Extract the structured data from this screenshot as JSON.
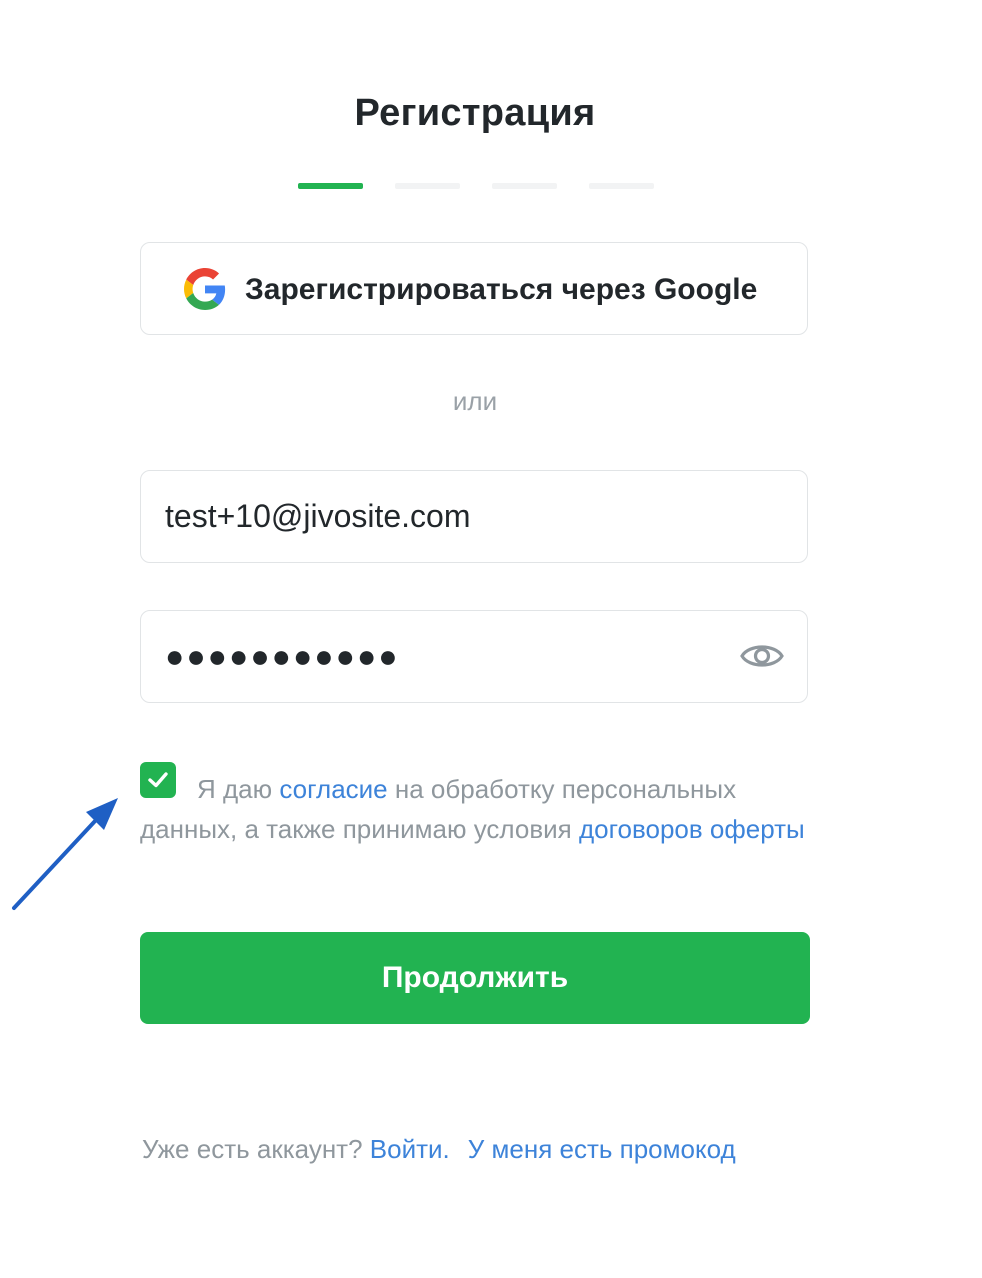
{
  "page": {
    "title": "Регистрация"
  },
  "steps": {
    "total": 4,
    "current": 1
  },
  "google": {
    "label": "Зарегистрироваться через Google",
    "icon": "google-icon"
  },
  "divider": {
    "or_text": "или"
  },
  "email": {
    "value": "test+10@jivosite.com"
  },
  "password": {
    "value": "●●●●●●●●●●●",
    "toggle_icon": "eye-icon"
  },
  "consent": {
    "checked": true,
    "text_1": "Я даю ",
    "link_1": "согласие",
    "text_2": " на обработку персональных данных, а также принимаю условия ",
    "link_2": "договоров оферты"
  },
  "continue_button": {
    "label": "Продолжить"
  },
  "footer": {
    "question": "Уже есть аккаунт? ",
    "login_link": "Войти.",
    "promo_link": "У меня есть промокод"
  },
  "colors": {
    "accent": "#22b351",
    "link": "#3d83d9",
    "muted": "#8f979d",
    "annotation_arrow": "#1f5fc4"
  }
}
